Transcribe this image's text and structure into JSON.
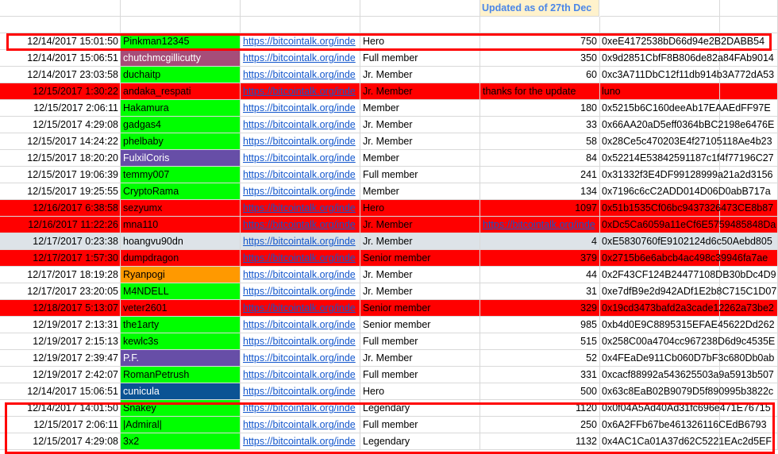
{
  "header": {
    "updated_label": "Updated as of 27th Dec"
  },
  "colors": {
    "row_red": "#ff0000",
    "green": "#00ff00",
    "mauve": "#a64d79",
    "purple": "#674ea7",
    "orange": "#ff9900",
    "blue": "#0b5394",
    "light_gray": "#dde3e8",
    "header_yellow": "#fff2cc",
    "link": "#1155cc",
    "highlight_border": "#ff0000"
  },
  "rows": [
    {
      "date": "12/14/2017 15:01:50",
      "name": "Pinkman12345",
      "link": "https://bitcointalk.org/inde",
      "rank": "Hero",
      "extra": "750",
      "addr": "0xeE4172538bD66d94e2B2DABB54",
      "name_bg": "green",
      "row_bg": "",
      "highlight": true
    },
    {
      "date": "12/14/2017 15:06:51",
      "name": "chutchmcgillicutty",
      "link": "https://bitcointalk.org/inde",
      "rank": "Full member",
      "extra": "350",
      "addr": "0x9d2851CbfF8B806de82a84FAb9014",
      "name_bg": "mauve",
      "row_bg": ""
    },
    {
      "date": "12/14/2017 23:03:58",
      "name": "duchaitp",
      "link": "https://bitcointalk.org/inde",
      "rank": "Jr. Member",
      "extra": "60",
      "addr": "0xc3A711DbC12f11db914b3A772dA53",
      "name_bg": "green",
      "row_bg": ""
    },
    {
      "date": "12/15/2017 1:30:22",
      "name": "andaka_respati",
      "link": "https://bitcointalk.org/inde",
      "rank": "Jr. Member",
      "extra": "thanks for the update",
      "addr": "luno",
      "name_bg": "",
      "row_bg": "red",
      "extra_left": true
    },
    {
      "date": "12/15/2017 2:06:11",
      "name": "Hakamura",
      "link": "https://bitcointalk.org/inde",
      "rank": "Member",
      "extra": "180",
      "addr": "0x5215b6C160deeAb17EAAEdFF97E",
      "name_bg": "green",
      "row_bg": ""
    },
    {
      "date": "12/15/2017 4:29:08",
      "name": "gadgas4",
      "link": "https://bitcointalk.org/inde",
      "rank": "Jr. Member",
      "extra": "33",
      "addr": "0x66AA20aD5eff0364bBC2198e6476E",
      "name_bg": "green",
      "row_bg": ""
    },
    {
      "date": "12/15/2017 14:24:22",
      "name": "phelbaby",
      "link": "https://bitcointalk.org/inde",
      "rank": "Jr. Member",
      "extra": "58",
      "addr": "0x28Ce5c470203E4f27105118Ae4b23",
      "name_bg": "green",
      "row_bg": ""
    },
    {
      "date": "12/15/2017 18:20:20",
      "name": "FulxilCoris",
      "link": "https://bitcointalk.org/inde",
      "rank": "Member",
      "extra": "84",
      "addr": "0x52214E53842591187c1f4f77196C27",
      "name_bg": "purple",
      "row_bg": ""
    },
    {
      "date": "12/15/2017 19:06:39",
      "name": "temmy007",
      "link": "https://bitcointalk.org/inde",
      "rank": "Full member",
      "extra": "241",
      "addr": "0x31332f3E4DF99128999a21a2d3156",
      "name_bg": "green",
      "row_bg": ""
    },
    {
      "date": "12/15/2017 19:25:55",
      "name": "CryptoRama",
      "link": "https://bitcointalk.org/inde",
      "rank": "Member",
      "extra": "134",
      "addr": "0x7196c6cC2ADD014D06D0abB717a",
      "name_bg": "green",
      "row_bg": ""
    },
    {
      "date": "12/16/2017 6:38:58",
      "name": "sezyumx",
      "link": "https://bitcointalk.org/inde",
      "rank": "Hero",
      "extra": "1097",
      "addr": "0x51b1535Cf06bc9437326473CE8b87",
      "name_bg": "",
      "row_bg": "red"
    },
    {
      "date": "12/16/2017 11:22:26",
      "name": "mna110",
      "link": "https://bitcointalk.org/inde",
      "rank": "Jr. Member",
      "extra": "https://bitcointalk.org/inde",
      "addr": "0xDc5Ca6059a11eCf6E5759485848Da",
      "name_bg": "",
      "row_bg": "red",
      "extra_link": true
    },
    {
      "date": "12/17/2017 0:23:38",
      "name": "hoangvu90dn",
      "link": "https://bitcointalk.org/inde",
      "rank": "Jr. Member",
      "extra": "4",
      "addr": "0xE5830760fE9102124d6c50Aebd805",
      "name_bg": "light_gray",
      "row_bg": "light_gray"
    },
    {
      "date": "12/17/2017 1:57:30",
      "name": "dumpdragon",
      "link": "https://bitcointalk.org/inde",
      "rank": "Senior member",
      "extra": "379",
      "addr": "0x2715b6e6abcb4ac498c39946fa7ae",
      "name_bg": "",
      "row_bg": "red"
    },
    {
      "date": "12/17/2017 18:19:28",
      "name": "Ryanpogi",
      "link": "https://bitcointalk.org/inde",
      "rank": "Jr. Member",
      "extra": "44",
      "addr": "0x2F43CF124B24477108DB30bDc4D9",
      "name_bg": "orange",
      "row_bg": ""
    },
    {
      "date": "12/17/2017 23:20:05",
      "name": "M4NDELL",
      "link": "https://bitcointalk.org/inde",
      "rank": "Jr. Member",
      "extra": "31",
      "addr": "0xe7dfB9e2d942ADf1E2b8C715C1D07",
      "name_bg": "green",
      "row_bg": ""
    },
    {
      "date": "12/18/2017 5:13:07",
      "name": "veter2601",
      "link": "https://bitcointalk.org/inde",
      "rank": "Senior member",
      "extra": "329",
      "addr": "0x19cd3473bafd2a3cade12262a73be2",
      "name_bg": "",
      "row_bg": "red"
    },
    {
      "date": "12/19/2017 2:13:31",
      "name": "the1arty",
      "link": "https://bitcointalk.org/inde",
      "rank": "Senior member",
      "extra": "985",
      "addr": "0xb4d0E9C8895315EFAE45622Dd262",
      "name_bg": "green",
      "row_bg": ""
    },
    {
      "date": "12/19/2017 2:15:13",
      "name": "kewlc3s",
      "link": "https://bitcointalk.org/inde",
      "rank": "Full member",
      "extra": "515",
      "addr": "0x258C00a4704cc967238D6d9c4535E",
      "name_bg": "green",
      "row_bg": ""
    },
    {
      "date": "12/19/2017 2:39:47",
      "name": "P.F.",
      "link": "https://bitcointalk.org/inde",
      "rank": "Jr. Member",
      "extra": "52",
      "addr": "0x4FEaDe911Cb060D7bF3c680Db0ab",
      "name_bg": "purple",
      "row_bg": ""
    },
    {
      "date": "12/19/2017 2:42:07",
      "name": "RomanPetrush",
      "link": "https://bitcointalk.org/inde",
      "rank": "Full member",
      "extra": "331",
      "addr": "0xcacf88992a543625503a9a5913b507",
      "name_bg": "green",
      "row_bg": ""
    },
    {
      "date": "12/14/2017 15:06:51",
      "name": "cunicula",
      "link": "https://bitcointalk.org/inde",
      "rank": "Hero",
      "extra": "500",
      "addr": "0x63c8EaB02B9079D5f890995b3822c",
      "name_bg": "blue",
      "row_bg": ""
    },
    {
      "date": "12/14/2017 14:01:50",
      "name": "Snakey",
      "link": "https://bitcointalk.org/inde",
      "rank": "Legendary",
      "extra": "1120",
      "addr": "0x0f04A5Ad40Ad31fc696e471E76715",
      "name_bg": "green",
      "row_bg": ""
    },
    {
      "date": "12/15/2017 2:06:11",
      "name": "|Admiral|",
      "link": "https://bitcointalk.org/inde",
      "rank": "Full member",
      "extra": "250",
      "addr": "0x6A2FFb67be461326116CEdB6793",
      "name_bg": "green",
      "row_bg": ""
    },
    {
      "date": "12/15/2017 4:29:08",
      "name": "3x2",
      "link": "https://bitcointalk.org/inde",
      "rank": "Legendary",
      "extra": "1132",
      "addr": "0x4AC1Ca01A37d62C5221EAc2d5EF",
      "name_bg": "green",
      "row_bg": ""
    }
  ]
}
